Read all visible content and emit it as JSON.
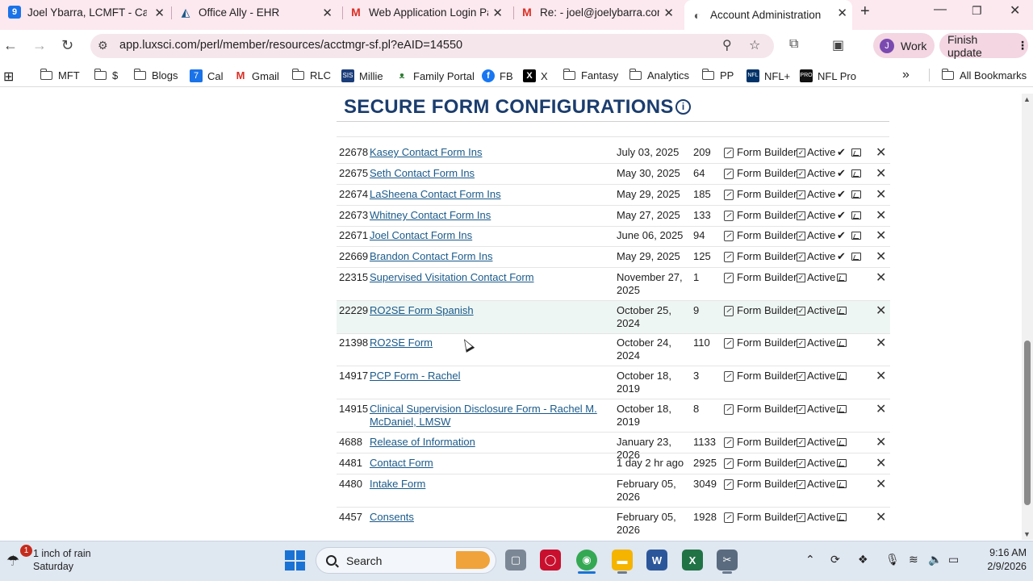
{
  "browser": {
    "tabs": [
      {
        "title": "Joel Ybarra, LCMFT - Caler",
        "icon": "calendar-icon"
      },
      {
        "title": "Office Ally - EHR",
        "icon": "office-ally-icon"
      },
      {
        "title": "Web Application Login Pa",
        "icon": "gmail-icon"
      },
      {
        "title": "Re: - joel@joelybarra.com",
        "icon": "gmail-icon"
      },
      {
        "title": "Account Administration",
        "icon": "globe-icon"
      }
    ],
    "url": "app.luxsci.com/perl/member/resources/acctmgr-sf.pl?eAID=14550",
    "profile_label": "Work",
    "profile_initial": "J",
    "finish_update_label": "Finish update",
    "bookmarks": [
      "MFT",
      "$",
      "Blogs",
      "Cal",
      "Gmail",
      "RLC",
      "Millie",
      "Family Portal",
      "FB",
      "X",
      "Fantasy",
      "Analytics",
      "PP",
      "NFL+",
      "NFL Pro"
    ],
    "all_bookmarks_label": "All Bookmarks"
  },
  "page": {
    "title": "SECURE FORM CONFIGURATIONS",
    "form_builder_label": "Form Builder",
    "active_label": "Active",
    "rows": [
      {
        "id": "22678",
        "name": "Kasey Contact Form Ins",
        "date": "July 03, 2025",
        "count": "209",
        "checked": true
      },
      {
        "id": "22675",
        "name": "Seth Contact Form Ins",
        "date": "May 30, 2025",
        "count": "64",
        "checked": true
      },
      {
        "id": "22674",
        "name": "LaSheena Contact Form Ins",
        "date": "May 29, 2025",
        "count": "185",
        "checked": true
      },
      {
        "id": "22673",
        "name": "Whitney Contact Form Ins",
        "date": "May 27, 2025",
        "count": "133",
        "checked": true
      },
      {
        "id": "22671",
        "name": "Joel Contact Form Ins",
        "date": "June 06, 2025",
        "count": "94",
        "checked": true
      },
      {
        "id": "22669",
        "name": "Brandon Contact Form Ins",
        "date": "May 29, 2025",
        "count": "125",
        "checked": true
      },
      {
        "id": "22315",
        "name": "Supervised Visitation Contact Form",
        "date": "November 27, 2025",
        "count": "1",
        "checked": false
      },
      {
        "id": "22229",
        "name": "RO2SE Form Spanish",
        "date": "October 25, 2024",
        "count": "9",
        "checked": false
      },
      {
        "id": "21398",
        "name": "RO2SE Form",
        "date": "October 24, 2024",
        "count": "110",
        "checked": false
      },
      {
        "id": "14917",
        "name": "PCP Form - Rachel",
        "date": "October 18, 2019",
        "count": "3",
        "checked": false
      },
      {
        "id": "14915",
        "name": "Clinical Supervision Disclosure Form - Rachel M. McDaniel, LMSW",
        "date": "October 18, 2019",
        "count": "8",
        "checked": false
      },
      {
        "id": "4688",
        "name": "Release of Information",
        "date": "January 23, 2026",
        "count": "1133",
        "checked": false
      },
      {
        "id": "4481",
        "name": "Contact Form",
        "date": "1 day 2 hr ago",
        "count": "2925",
        "checked": false
      },
      {
        "id": "4480",
        "name": "Intake Form",
        "date": "February 05, 2026",
        "count": "3049",
        "checked": false
      },
      {
        "id": "4457",
        "name": "Consents",
        "date": "February 05, 2026",
        "count": "1928",
        "checked": false
      }
    ]
  },
  "taskbar": {
    "weather_line1": "1 inch of rain",
    "weather_line2": "Saturday",
    "weather_badge": "1",
    "search_label": "Search",
    "time": "9:16 AM",
    "date": "2/9/2026"
  }
}
